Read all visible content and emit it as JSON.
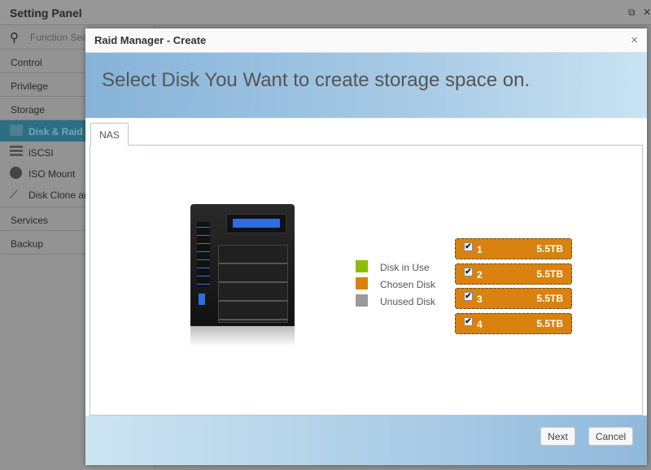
{
  "app": {
    "title": "Setting Panel",
    "search_placeholder": "Function Search",
    "sidebar": {
      "sections": [
        "Control",
        "Privilege",
        "Storage"
      ],
      "storage_items": [
        "Disk & Raid",
        "iSCSI",
        "ISO Mount",
        "Disk Clone and Wipe"
      ],
      "more_sections": [
        "Services",
        "Backup"
      ]
    }
  },
  "dialog": {
    "title": "Raid Manager - Create",
    "close": "×",
    "heading": "Select Disk You Want to create storage space on.",
    "tab": "NAS",
    "legend": [
      {
        "label": "Disk in Use",
        "color": "#8dbd0c"
      },
      {
        "label": "Chosen Disk",
        "color": "#d9820f"
      },
      {
        "label": "Unused Disk",
        "color": "#9a9a9a"
      }
    ],
    "disks": [
      {
        "num": "1",
        "size": "5.5TB",
        "checked": true
      },
      {
        "num": "2",
        "size": "5.5TB",
        "checked": true
      },
      {
        "num": "3",
        "size": "5.5TB",
        "checked": true
      },
      {
        "num": "4",
        "size": "5.5TB",
        "checked": true
      }
    ],
    "next": "Next",
    "cancel": "Cancel"
  }
}
